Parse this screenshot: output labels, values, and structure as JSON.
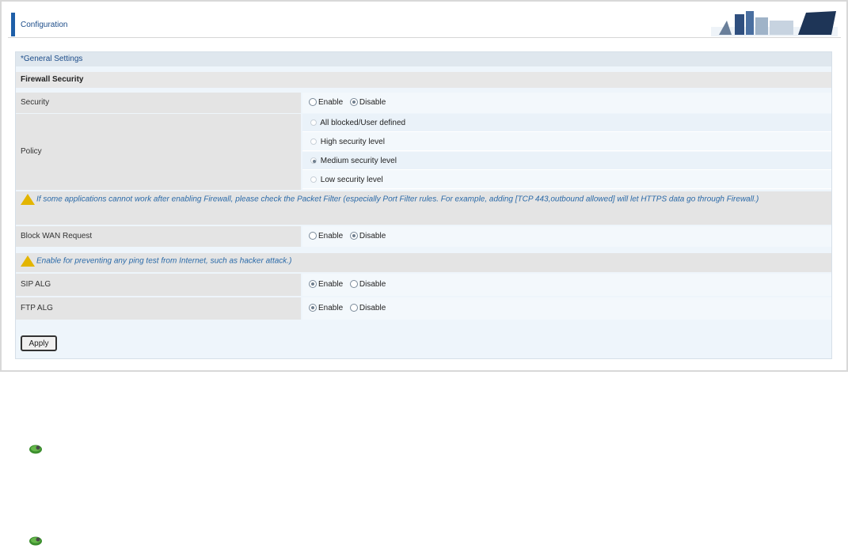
{
  "header": {
    "title": "Configuration"
  },
  "section": {
    "title": "General Settings"
  },
  "firewall": {
    "group_title": "Firewall Security",
    "security": {
      "label": "Security",
      "options": [
        "Enable",
        "Disable"
      ],
      "selected": "Disable"
    },
    "policy": {
      "label": "Policy",
      "options": [
        "All blocked/User defined",
        "High security level",
        "Medium security level",
        "Low security level"
      ],
      "selected": "Medium security level"
    },
    "policy_note": "If some applications cannot work after enabling Firewall, please check the Packet Filter (especially Port Filter rules. For example, adding [TCP 443,outbound allowed] will let HTTPS data go through Firewall.)",
    "block_wan": {
      "label": "Block WAN Request",
      "options": [
        "Enable",
        "Disable"
      ],
      "selected": "Disable"
    },
    "block_note": "Enable for preventing any ping test from Internet, such as hacker attack.)",
    "sip_alg": {
      "label": "SIP ALG",
      "options": [
        "Enable",
        "Disable"
      ],
      "selected": "Enable"
    },
    "ftp_alg": {
      "label": "FTP ALG",
      "options": [
        "Enable",
        "Disable"
      ],
      "selected": "Enable"
    }
  },
  "buttons": {
    "apply": "Apply"
  },
  "colors": {
    "accent": "#1f5fa8",
    "panel_bg": "#eef5fb",
    "label_bg": "#e4e4e4",
    "note_text": "#2b6aa8"
  },
  "icons": {
    "bullet": "green-gear-icon",
    "warning": "warning-triangle-icon"
  }
}
